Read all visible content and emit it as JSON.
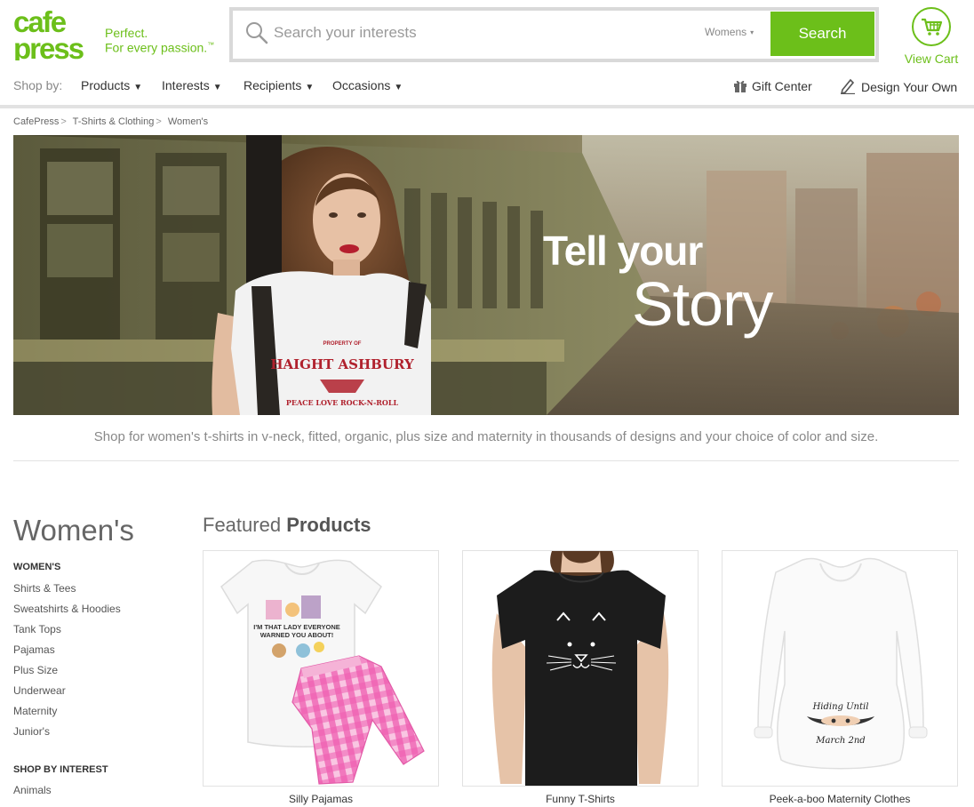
{
  "brand": {
    "logo_line1": "cafe",
    "logo_line2": "press",
    "tagline_line1": "Perfect.",
    "tagline_line2": "For every passion.",
    "trademark": "™",
    "color": "#6cbf1a"
  },
  "search": {
    "placeholder": "Search your interests",
    "scope": "Womens",
    "button_label": "Search"
  },
  "cart": {
    "label": "View Cart"
  },
  "nav": {
    "shop_by": "Shop by:",
    "items": [
      {
        "label": "Products"
      },
      {
        "label": "Interests"
      },
      {
        "label": "Recipients"
      },
      {
        "label": "Occasions"
      }
    ],
    "gift_center": "Gift Center",
    "design_your_own": "Design Your Own"
  },
  "breadcrumb": [
    "CafePress",
    "T-Shirts & Clothing",
    "Women's"
  ],
  "hero": {
    "line1": "Tell your",
    "line2": "Story",
    "shirt_text1": "PROPERTY OF",
    "shirt_text2": "HAIGHT ASHBURY",
    "shirt_text3": "PEACE LOVE ROCK-N-ROLL"
  },
  "tagline": "Shop for women's t-shirts in v-neck, fitted, organic, plus size and maternity in thousands of designs and your choice of color and size.",
  "sidebar": {
    "title": "Women's",
    "section1_heading": "WOMEN'S",
    "links": [
      "Shirts & Tees",
      "Sweatshirts & Hoodies",
      "Tank Tops",
      "Pajamas",
      "Plus Size",
      "Underwear",
      "Maternity",
      "Junior's"
    ],
    "section2_heading": "SHOP BY INTEREST",
    "interest_links": [
      "Animals"
    ]
  },
  "featured": {
    "title_light": "Featured",
    "title_bold": "Products",
    "products": [
      {
        "label": "Silly Pajamas",
        "print_line1": "I'M THAT LADY EVERYONE",
        "print_line2": "WARNED YOU ABOUT!"
      },
      {
        "label": "Funny T-Shirts"
      },
      {
        "label": "Peek-a-boo Maternity Clothes",
        "print_line1": "Hiding Until",
        "print_line2": "March 2nd"
      }
    ]
  }
}
